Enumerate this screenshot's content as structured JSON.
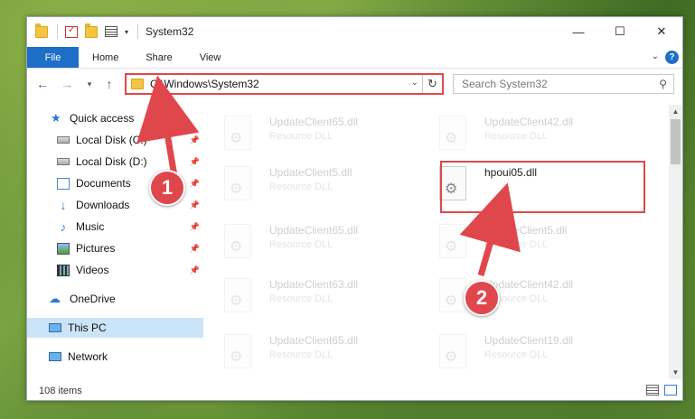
{
  "window": {
    "title": "System32",
    "controls": {
      "minimize": "—",
      "maximize": "☐",
      "close": "✕"
    }
  },
  "ribbon": {
    "tabs": [
      "File",
      "Home",
      "Share",
      "View"
    ],
    "help": "?"
  },
  "address": {
    "path": "C:\\Windows\\System32",
    "search_placeholder": "Search System32"
  },
  "sidebar": {
    "items": [
      {
        "label": "Quick access",
        "icon": "star-icon"
      },
      {
        "label": "Local Disk (C:)",
        "icon": "disk-icon",
        "pinned": true
      },
      {
        "label": "Local Disk (D:)",
        "icon": "disk-icon",
        "pinned": true
      },
      {
        "label": "Documents",
        "icon": "document-icon",
        "pinned": true
      },
      {
        "label": "Downloads",
        "icon": "download-icon",
        "pinned": true
      },
      {
        "label": "Music",
        "icon": "music-icon",
        "pinned": true
      },
      {
        "label": "Pictures",
        "icon": "pictures-icon",
        "pinned": true
      },
      {
        "label": "Videos",
        "icon": "videos-icon",
        "pinned": true
      },
      {
        "label": "OneDrive",
        "icon": "cloud-icon"
      },
      {
        "label": "This PC",
        "icon": "computer-icon",
        "selected": true
      },
      {
        "label": "Network",
        "icon": "network-icon"
      }
    ]
  },
  "files": [
    {
      "name": "UpdateClient65.dll",
      "type": "Resource DLL"
    },
    {
      "name": "UpdateClient42.dll",
      "type": "Resource DLL"
    },
    {
      "name": "UpdateClient5.dll",
      "type": "Resource DLL"
    },
    {
      "name": "hpoui05.dll",
      "type": ""
    },
    {
      "name": "UpdateClient65.dll",
      "type": "Resource DLL"
    },
    {
      "name": "UpdateClient5.dll",
      "type": "Resource DLL"
    },
    {
      "name": "UpdateClient63.dll",
      "type": "Resource DLL"
    },
    {
      "name": "UpdateClient42.dll",
      "type": "Resource DLL"
    },
    {
      "name": "UpdateClient65.dll",
      "type": "Resource DLL"
    },
    {
      "name": "UpdateClient19.dll",
      "type": "Resource DLL"
    }
  ],
  "status": {
    "item_count": "108 items"
  },
  "annotations": {
    "marker1": "1",
    "marker2": "2",
    "color": "#e0474c"
  },
  "colors": {
    "accent": "#1c6ec7",
    "highlight": "#e0474c",
    "selection": "#cce4f7"
  }
}
